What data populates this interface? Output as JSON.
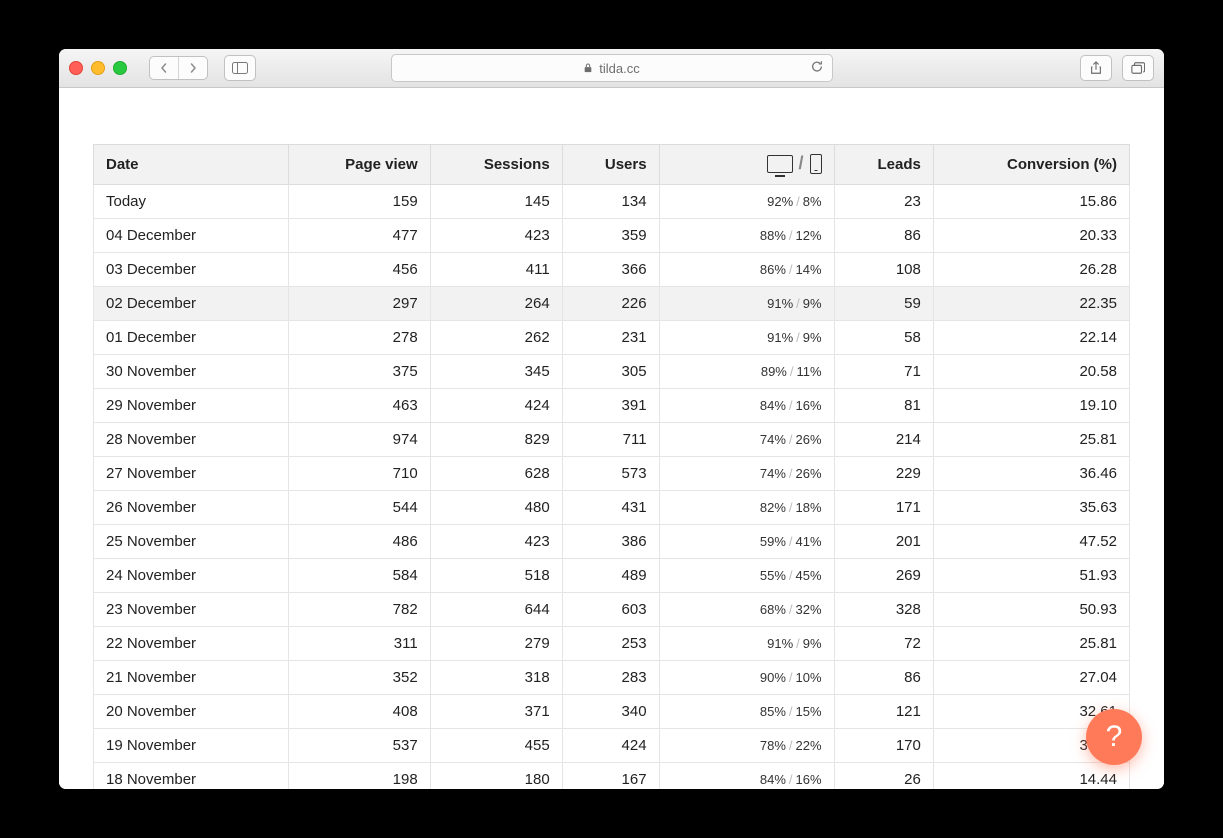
{
  "chrome": {
    "url_host": "tilda.cc",
    "new_tab": "+"
  },
  "help_label": "?",
  "table": {
    "headers": {
      "date": "Date",
      "page_view": "Page view",
      "sessions": "Sessions",
      "users": "Users",
      "leads": "Leads",
      "conversion": "Conversion (%)"
    },
    "rows": [
      {
        "date": "Today",
        "page_view": "159",
        "sessions": "145",
        "users": "134",
        "desktop": "92%",
        "mobile": "8%",
        "leads": "23",
        "conversion": "15.86"
      },
      {
        "date": "04 December",
        "page_view": "477",
        "sessions": "423",
        "users": "359",
        "desktop": "88%",
        "mobile": "12%",
        "leads": "86",
        "conversion": "20.33"
      },
      {
        "date": "03 December",
        "page_view": "456",
        "sessions": "411",
        "users": "366",
        "desktop": "86%",
        "mobile": "14%",
        "leads": "108",
        "conversion": "26.28"
      },
      {
        "date": "02 December",
        "page_view": "297",
        "sessions": "264",
        "users": "226",
        "desktop": "91%",
        "mobile": "9%",
        "leads": "59",
        "conversion": "22.35",
        "hover": true
      },
      {
        "date": "01 December",
        "page_view": "278",
        "sessions": "262",
        "users": "231",
        "desktop": "91%",
        "mobile": "9%",
        "leads": "58",
        "conversion": "22.14"
      },
      {
        "date": "30 November",
        "page_view": "375",
        "sessions": "345",
        "users": "305",
        "desktop": "89%",
        "mobile": "11%",
        "leads": "71",
        "conversion": "20.58"
      },
      {
        "date": "29 November",
        "page_view": "463",
        "sessions": "424",
        "users": "391",
        "desktop": "84%",
        "mobile": "16%",
        "leads": "81",
        "conversion": "19.10"
      },
      {
        "date": "28 November",
        "page_view": "974",
        "sessions": "829",
        "users": "711",
        "desktop": "74%",
        "mobile": "26%",
        "leads": "214",
        "conversion": "25.81"
      },
      {
        "date": "27 November",
        "page_view": "710",
        "sessions": "628",
        "users": "573",
        "desktop": "74%",
        "mobile": "26%",
        "leads": "229",
        "conversion": "36.46"
      },
      {
        "date": "26 November",
        "page_view": "544",
        "sessions": "480",
        "users": "431",
        "desktop": "82%",
        "mobile": "18%",
        "leads": "171",
        "conversion": "35.63"
      },
      {
        "date": "25 November",
        "page_view": "486",
        "sessions": "423",
        "users": "386",
        "desktop": "59%",
        "mobile": "41%",
        "leads": "201",
        "conversion": "47.52"
      },
      {
        "date": "24 November",
        "page_view": "584",
        "sessions": "518",
        "users": "489",
        "desktop": "55%",
        "mobile": "45%",
        "leads": "269",
        "conversion": "51.93"
      },
      {
        "date": "23 November",
        "page_view": "782",
        "sessions": "644",
        "users": "603",
        "desktop": "68%",
        "mobile": "32%",
        "leads": "328",
        "conversion": "50.93"
      },
      {
        "date": "22 November",
        "page_view": "311",
        "sessions": "279",
        "users": "253",
        "desktop": "91%",
        "mobile": "9%",
        "leads": "72",
        "conversion": "25.81"
      },
      {
        "date": "21 November",
        "page_view": "352",
        "sessions": "318",
        "users": "283",
        "desktop": "90%",
        "mobile": "10%",
        "leads": "86",
        "conversion": "27.04"
      },
      {
        "date": "20 November",
        "page_view": "408",
        "sessions": "371",
        "users": "340",
        "desktop": "85%",
        "mobile": "15%",
        "leads": "121",
        "conversion": "32.61"
      },
      {
        "date": "19 November",
        "page_view": "537",
        "sessions": "455",
        "users": "424",
        "desktop": "78%",
        "mobile": "22%",
        "leads": "170",
        "conversion": "37.36"
      },
      {
        "date": "18 November",
        "page_view": "198",
        "sessions": "180",
        "users": "167",
        "desktop": "84%",
        "mobile": "16%",
        "leads": "26",
        "conversion": "14.44"
      }
    ]
  }
}
